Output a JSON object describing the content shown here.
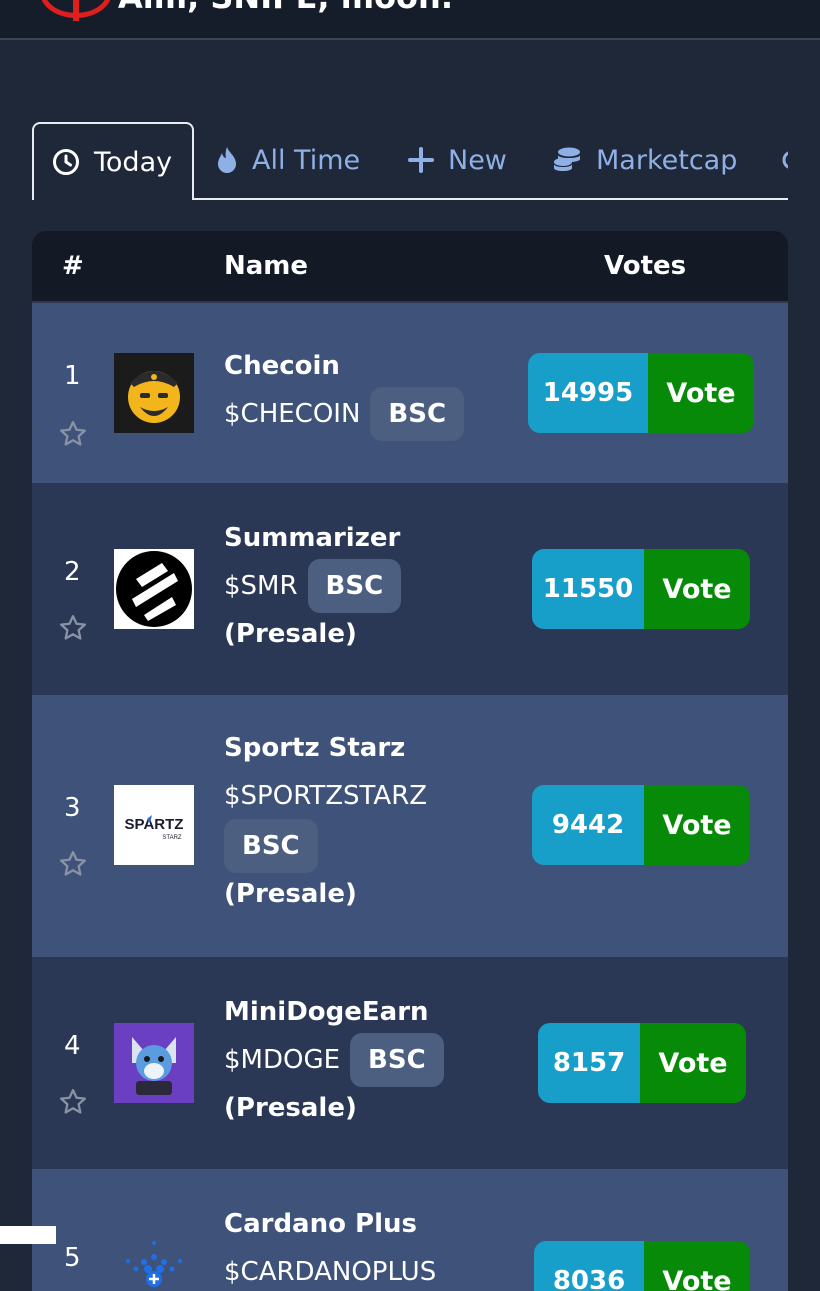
{
  "brand": {
    "tagline": "Aim, SNIPE, moon."
  },
  "tabs": [
    {
      "label": "Today",
      "icon": "clock-icon",
      "active": true
    },
    {
      "label": "All Time",
      "icon": "flame-icon"
    },
    {
      "label": "New",
      "icon": "plus-icon"
    },
    {
      "label": "Marketcap",
      "icon": "coins-icon"
    }
  ],
  "table": {
    "headers": {
      "rank": "#",
      "name": "Name",
      "votes": "Votes"
    },
    "vote_label": "Vote",
    "rows": [
      {
        "rank": "1",
        "name": "Checoin",
        "ticker": "$CHECOIN",
        "chain": "BSC",
        "presale": "",
        "votes": "14995"
      },
      {
        "rank": "2",
        "name": "Summarizer",
        "ticker": "$SMR",
        "chain": "BSC",
        "presale": "(Presale)",
        "votes": "11550"
      },
      {
        "rank": "3",
        "name": "Sportz Starz",
        "ticker": "$SPORTZSTARZ",
        "chain": "BSC",
        "presale": "(Presale)",
        "votes": "9442"
      },
      {
        "rank": "4",
        "name": "MiniDogeEarn",
        "ticker": "$MDOGE",
        "chain": "BSC",
        "presale": "(Presale)",
        "votes": "8157"
      },
      {
        "rank": "5",
        "name": "Cardano Plus",
        "ticker": "$CARDANOPLUS",
        "chain": "",
        "presale": "",
        "votes": "8036"
      }
    ]
  },
  "logos": {
    "sportz_text": "SPARTZ",
    "sportz_sub": "STARZ"
  },
  "colors": {
    "background": "#1f2838",
    "row_odd": "#3f527a",
    "row_even": "#2a3755",
    "vote_count": "#179fca",
    "vote_button": "#078a07",
    "chain_badge": "#4d5f80",
    "tab_inactive": "#8fb0e6"
  }
}
